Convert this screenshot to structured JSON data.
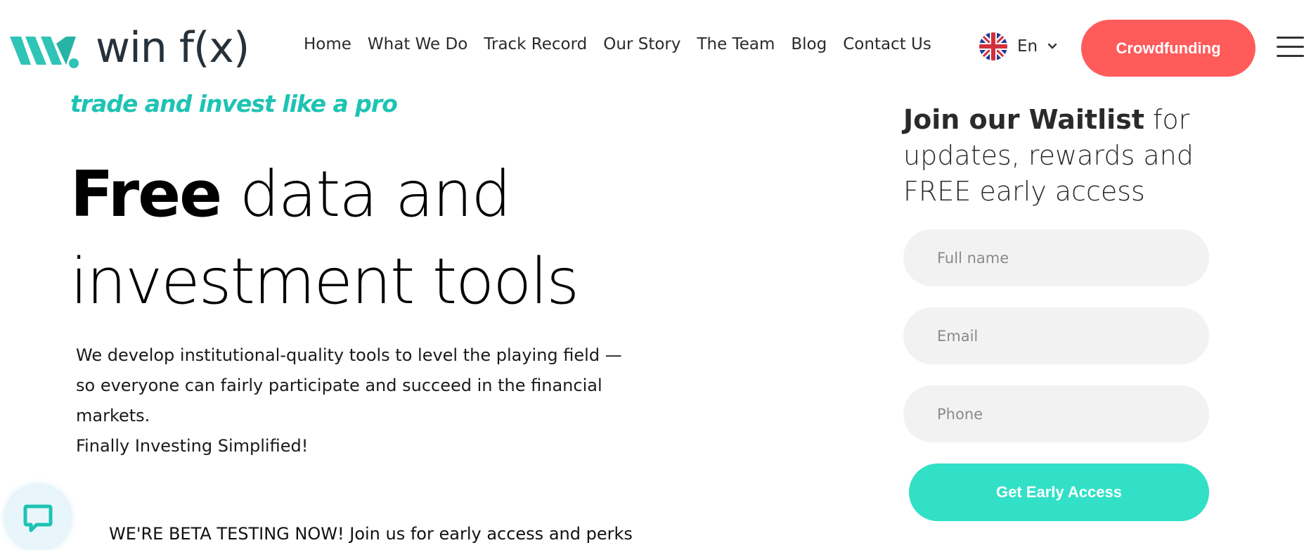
{
  "brand": {
    "logo_text": "win f(x)",
    "logo_icon": "winfx-w-mark",
    "accent_color": "#1ec3b3"
  },
  "nav": {
    "items": [
      {
        "label": "Home"
      },
      {
        "label": "What We Do"
      },
      {
        "label": "Track Record"
      },
      {
        "label": "Our Story"
      },
      {
        "label": "The Team"
      },
      {
        "label": "Blog"
      },
      {
        "label": "Contact Us"
      }
    ],
    "language": {
      "label": "En",
      "flag_icon": "uk-flag-icon"
    },
    "crowdfunding_label": "Crowdfunding",
    "crowdfunding_color": "#ff5b5b",
    "menu_icon": "hamburger-icon"
  },
  "hero": {
    "tagline": "trade and invest like a pro",
    "headline_bold": "Free",
    "headline_rest_line1": "data and",
    "headline_line2": "investment tools",
    "description_line1": "We develop institutional-quality tools to level the playing field —",
    "description_line2": "so everyone can fairly participate and succeed in the financial",
    "description_line3": "markets.",
    "description_line4": "Finally Investing Simplified!",
    "beta_text": "WE'RE BETA TESTING NOW! Join us for early access and perks"
  },
  "waitlist": {
    "title_bold": "Join our Waitlist",
    "title_rest": " for updates, rewards and FREE early access",
    "fullname_placeholder": "Full name",
    "email_placeholder": "Email",
    "phone_placeholder": "Phone",
    "submit_label": "Get Early Access",
    "submit_color": "#31e0c6"
  },
  "chat": {
    "icon": "chat-bubble-icon"
  }
}
